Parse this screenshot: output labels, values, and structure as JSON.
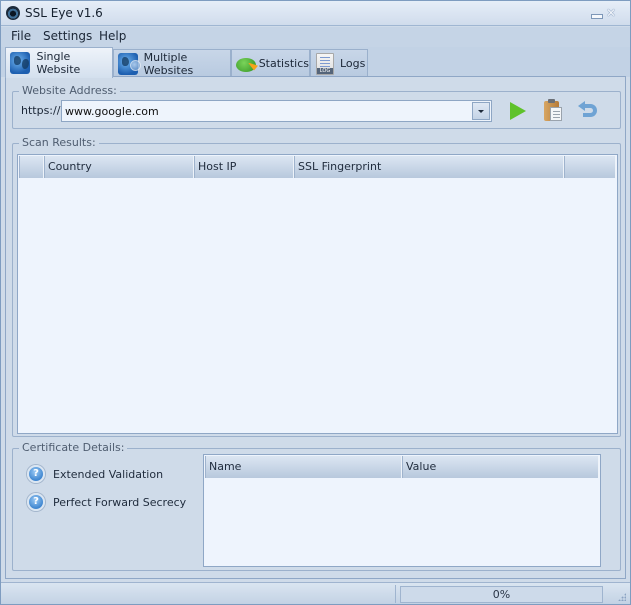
{
  "window": {
    "title": "SSL Eye v1.6",
    "minimize_label": "",
    "close_label": "✕"
  },
  "menu": [
    {
      "label": "File"
    },
    {
      "label": "Settings"
    },
    {
      "label": "Help"
    }
  ],
  "tabs": [
    {
      "label": "Single Website",
      "icon": "globe-icon",
      "active": true
    },
    {
      "label": "Multiple Websites",
      "icon": "globe-multi-icon",
      "active": false
    },
    {
      "label": "Statistics",
      "icon": "pie-chart-icon",
      "active": false
    },
    {
      "label": "Logs",
      "icon": "log-file-icon",
      "active": false
    }
  ],
  "website_address": {
    "title": "Website Address:",
    "prefix": "https://",
    "url_value": "www.google.com",
    "buttons": [
      {
        "name": "start-scan",
        "icon": "play-icon"
      },
      {
        "name": "paste",
        "icon": "clipboard-icon"
      },
      {
        "name": "reset",
        "icon": "undo-icon"
      }
    ]
  },
  "scan_results": {
    "title": "Scan Results:",
    "columns": [
      "",
      "Country",
      "Host IP",
      "SSL Fingerprint",
      ""
    ],
    "rows": []
  },
  "certificate_details": {
    "title": "Certificate Details:",
    "checks": [
      {
        "label": "Extended Validation",
        "status_icon": "question-icon"
      },
      {
        "label": "Perfect Forward Secrecy",
        "status_icon": "question-icon"
      }
    ],
    "columns": [
      "Name",
      "Value"
    ],
    "rows": []
  },
  "status_bar": {
    "progress_text": "0%",
    "progress_value": 0
  }
}
